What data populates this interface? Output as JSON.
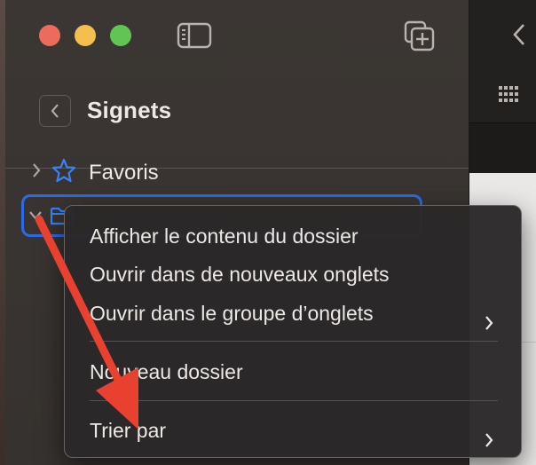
{
  "sidebar": {
    "title": "Signets",
    "items": [
      {
        "label": "Favoris",
        "icon": "star-icon"
      },
      {
        "label": "",
        "icon": "folder-icon",
        "selected": true
      }
    ]
  },
  "context_menu": {
    "items": [
      {
        "label": "Afficher le contenu du dossier",
        "submenu": false
      },
      {
        "label": "Ouvrir dans de nouveaux onglets",
        "submenu": false
      },
      {
        "label": "Ouvrir dans le groupe d’onglets",
        "submenu": true
      },
      {
        "label": "Nouveau dossier",
        "submenu": false
      },
      {
        "label": "Trier par",
        "submenu": true
      }
    ]
  },
  "colors": {
    "accent": "#2c6be5",
    "annotation_arrow": "#e8412f",
    "close": "#ed6a5e",
    "minimize": "#f4bf4f",
    "zoom": "#61c554"
  }
}
